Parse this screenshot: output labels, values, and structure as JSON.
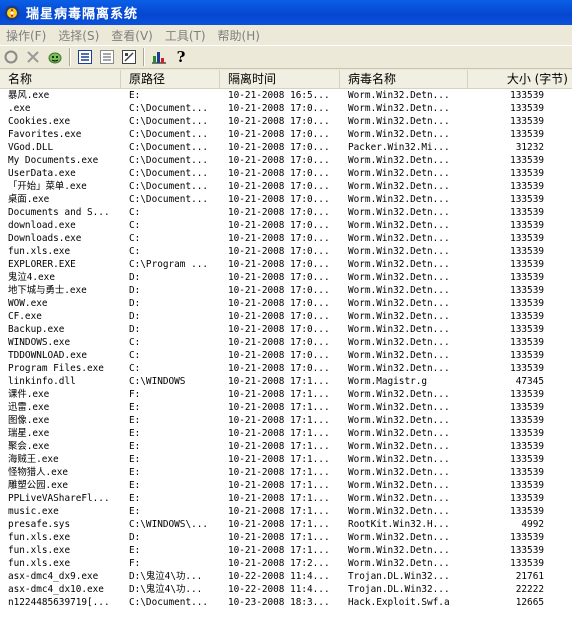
{
  "window": {
    "title": "瑞星病毒隔离系统"
  },
  "menu": [
    "操作(F)",
    "选择(S)",
    "查看(V)",
    "工具(T)",
    "帮助(H)"
  ],
  "toolbar": {
    "icons": [
      "refresh-icon",
      "delete-icon",
      "restore-icon",
      "select-all-icon",
      "invert-selection-icon",
      "properties-icon",
      "statistics-icon",
      "help-icon"
    ],
    "help_glyph": "?"
  },
  "columns": [
    "名称",
    "原路径",
    "隔离时间",
    "病毒名称",
    "大小 (字节)"
  ],
  "rows": [
    [
      "暴风.exe",
      "E:",
      "10-21-2008 16:5...",
      "Worm.Win32.Detn...",
      "133539"
    ],
    [
      ".exe",
      "C:\\Document...",
      "10-21-2008 17:0...",
      "Worm.Win32.Detn...",
      "133539"
    ],
    [
      "Cookies.exe",
      "C:\\Document...",
      "10-21-2008 17:0...",
      "Worm.Win32.Detn...",
      "133539"
    ],
    [
      "Favorites.exe",
      "C:\\Document...",
      "10-21-2008 17:0...",
      "Worm.Win32.Detn...",
      "133539"
    ],
    [
      "VGod.DLL",
      "C:\\Document...",
      "10-21-2008 17:0...",
      "Packer.Win32.Mi...",
      "31232"
    ],
    [
      "My Documents.exe",
      "C:\\Document...",
      "10-21-2008 17:0...",
      "Worm.Win32.Detn...",
      "133539"
    ],
    [
      "UserData.exe",
      "C:\\Document...",
      "10-21-2008 17:0...",
      "Worm.Win32.Detn...",
      "133539"
    ],
    [
      "「开始」菜单.exe",
      "C:\\Document...",
      "10-21-2008 17:0...",
      "Worm.Win32.Detn...",
      "133539"
    ],
    [
      "桌面.exe",
      "C:\\Document...",
      "10-21-2008 17:0...",
      "Worm.Win32.Detn...",
      "133539"
    ],
    [
      "Documents and S...",
      "C:",
      "10-21-2008 17:0...",
      "Worm.Win32.Detn...",
      "133539"
    ],
    [
      "download.exe",
      "C:",
      "10-21-2008 17:0...",
      "Worm.Win32.Detn...",
      "133539"
    ],
    [
      "Downloads.exe",
      "C:",
      "10-21-2008 17:0...",
      "Worm.Win32.Detn...",
      "133539"
    ],
    [
      "fun.xls.exe",
      "C:",
      "10-21-2008 17:0...",
      "Worm.Win32.Detn...",
      "133539"
    ],
    [
      "EXPLORER.EXE",
      "C:\\Program ...",
      "10-21-2008 17:0...",
      "Worm.Win32.Detn...",
      "133539"
    ],
    [
      "鬼泣4.exe",
      "D:",
      "10-21-2008 17:0...",
      "Worm.Win32.Detn...",
      "133539"
    ],
    [
      "地下城与勇士.exe",
      "D:",
      "10-21-2008 17:0...",
      "Worm.Win32.Detn...",
      "133539"
    ],
    [
      "WOW.exe",
      "D:",
      "10-21-2008 17:0...",
      "Worm.Win32.Detn...",
      "133539"
    ],
    [
      "CF.exe",
      "D:",
      "10-21-2008 17:0...",
      "Worm.Win32.Detn...",
      "133539"
    ],
    [
      "Backup.exe",
      "D:",
      "10-21-2008 17:0...",
      "Worm.Win32.Detn...",
      "133539"
    ],
    [
      "WINDOWS.exe",
      "C:",
      "10-21-2008 17:0...",
      "Worm.Win32.Detn...",
      "133539"
    ],
    [
      "TDDOWNLOAD.exe",
      "C:",
      "10-21-2008 17:0...",
      "Worm.Win32.Detn...",
      "133539"
    ],
    [
      "Program Files.exe",
      "C:",
      "10-21-2008 17:0...",
      "Worm.Win32.Detn...",
      "133539"
    ],
    [
      "linkinfo.dll",
      "C:\\WINDOWS",
      "10-21-2008 17:1...",
      "Worm.Magistr.g",
      "47345"
    ],
    [
      "课件.exe",
      "F:",
      "10-21-2008 17:1...",
      "Worm.Win32.Detn...",
      "133539"
    ],
    [
      "迅雷.exe",
      "E:",
      "10-21-2008 17:1...",
      "Worm.Win32.Detn...",
      "133539"
    ],
    [
      "图像.exe",
      "E:",
      "10-21-2008 17:1...",
      "Worm.Win32.Detn...",
      "133539"
    ],
    [
      "瑞星.exe",
      "E:",
      "10-21-2008 17:1...",
      "Worm.Win32.Detn...",
      "133539"
    ],
    [
      "聚会.exe",
      "E:",
      "10-21-2008 17:1...",
      "Worm.Win32.Detn...",
      "133539"
    ],
    [
      "海贼王.exe",
      "E:",
      "10-21-2008 17:1...",
      "Worm.Win32.Detn...",
      "133539"
    ],
    [
      "怪物猎人.exe",
      "E:",
      "10-21-2008 17:1...",
      "Worm.Win32.Detn...",
      "133539"
    ],
    [
      "雕塑公园.exe",
      "E:",
      "10-21-2008 17:1...",
      "Worm.Win32.Detn...",
      "133539"
    ],
    [
      "PPLiveVAShareFl...",
      "E:",
      "10-21-2008 17:1...",
      "Worm.Win32.Detn...",
      "133539"
    ],
    [
      "music.exe",
      "E:",
      "10-21-2008 17:1...",
      "Worm.Win32.Detn...",
      "133539"
    ],
    [
      "presafe.sys",
      "C:\\WINDOWS\\...",
      "10-21-2008 17:1...",
      "RootKit.Win32.H...",
      "4992"
    ],
    [
      "fun.xls.exe",
      "D:",
      "10-21-2008 17:1...",
      "Worm.Win32.Detn...",
      "133539"
    ],
    [
      "fun.xls.exe",
      "E:",
      "10-21-2008 17:1...",
      "Worm.Win32.Detn...",
      "133539"
    ],
    [
      "fun.xls.exe",
      "F:",
      "10-21-2008 17:2...",
      "Worm.Win32.Detn...",
      "133539"
    ],
    [
      "asx-dmc4_dx9.exe",
      "D:\\鬼泣4\\功...",
      "10-22-2008 11:4...",
      "Trojan.DL.Win32...",
      "21761"
    ],
    [
      "asx-dmc4_dx10.exe",
      "D:\\鬼泣4\\功...",
      "10-22-2008 11:4...",
      "Trojan.DL.Win32...",
      "22222"
    ],
    [
      "n1224485639719[...",
      "C:\\Document...",
      "10-23-2008 18:3...",
      "Hack.Exploit.Swf.a",
      "12665"
    ]
  ]
}
